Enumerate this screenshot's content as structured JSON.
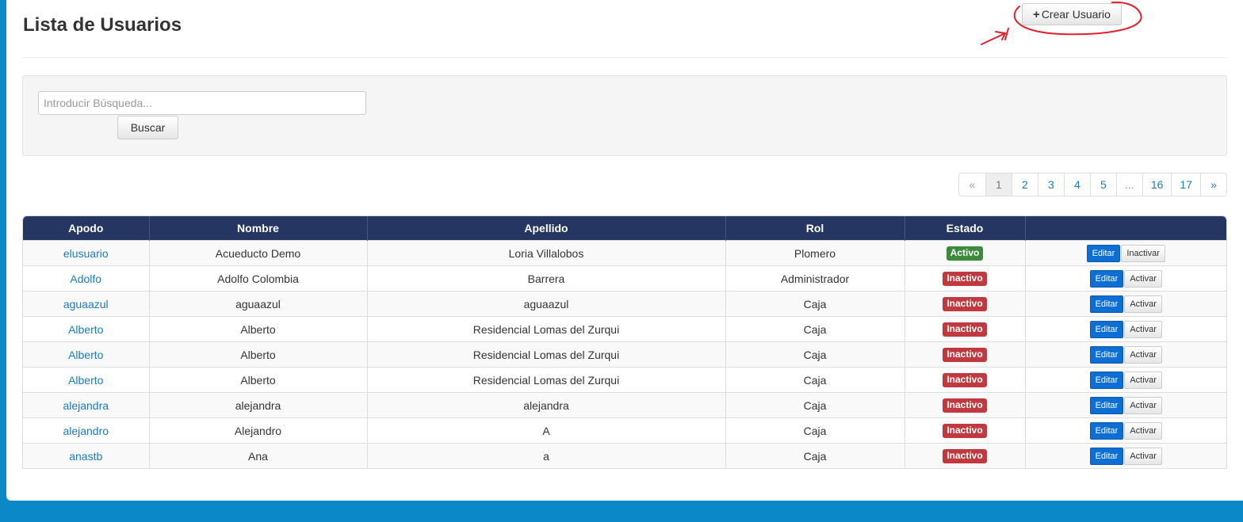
{
  "header": {
    "title": "Lista de Usuarios",
    "create_button": "Crear Usuario",
    "create_icon": "plus-icon"
  },
  "search": {
    "placeholder": "Introducir Búsqueda...",
    "value": "",
    "button_label": "Buscar"
  },
  "pagination": {
    "items": [
      "«",
      "1",
      "2",
      "3",
      "4",
      "5",
      "...",
      "16",
      "17",
      "»"
    ],
    "current": "1"
  },
  "table": {
    "columns": [
      "Apodo",
      "Nombre",
      "Apellido",
      "Rol",
      "Estado",
      ""
    ],
    "rows": [
      {
        "apodo": "elusuario",
        "nombre": "Acueducto Demo",
        "apellido": "Loria Villalobos",
        "rol": "Plomero",
        "estado": "Activo",
        "edit": "Editar",
        "toggle": "Inactivar"
      },
      {
        "apodo": "Adolfo",
        "nombre": "Adolfo Colombia",
        "apellido": "Barrera",
        "rol": "Administrador",
        "estado": "Inactivo",
        "edit": "Editar",
        "toggle": "Activar"
      },
      {
        "apodo": "aguaazul",
        "nombre": "aguaazul",
        "apellido": "aguaazul",
        "rol": "Caja",
        "estado": "Inactivo",
        "edit": "Editar",
        "toggle": "Activar"
      },
      {
        "apodo": "Alberto",
        "nombre": "Alberto",
        "apellido": "Residencial Lomas del Zurqui",
        "rol": "Caja",
        "estado": "Inactivo",
        "edit": "Editar",
        "toggle": "Activar"
      },
      {
        "apodo": "Alberto",
        "nombre": "Alberto",
        "apellido": "Residencial Lomas del Zurqui",
        "rol": "Caja",
        "estado": "Inactivo",
        "edit": "Editar",
        "toggle": "Activar"
      },
      {
        "apodo": "Alberto",
        "nombre": "Alberto",
        "apellido": "Residencial Lomas del Zurqui",
        "rol": "Caja",
        "estado": "Inactivo",
        "edit": "Editar",
        "toggle": "Activar"
      },
      {
        "apodo": "alejandra",
        "nombre": "alejandra",
        "apellido": "alejandra",
        "rol": "Caja",
        "estado": "Inactivo",
        "edit": "Editar",
        "toggle": "Activar"
      },
      {
        "apodo": "alejandro",
        "nombre": "Alejandro",
        "apellido": "A",
        "rol": "Caja",
        "estado": "Inactivo",
        "edit": "Editar",
        "toggle": "Activar"
      },
      {
        "apodo": "anastb",
        "nombre": "Ana",
        "apellido": "a",
        "rol": "Caja",
        "estado": "Inactivo",
        "edit": "Editar",
        "toggle": "Activar"
      }
    ]
  },
  "colors": {
    "table_header": "#263663",
    "active_badge": "#3c8a3c",
    "inactive_badge": "#c0393f",
    "edit_button": "#0d6fd4",
    "link": "#1a7bbf",
    "annotation": "#e0202a",
    "frame": "#0a88c8"
  }
}
